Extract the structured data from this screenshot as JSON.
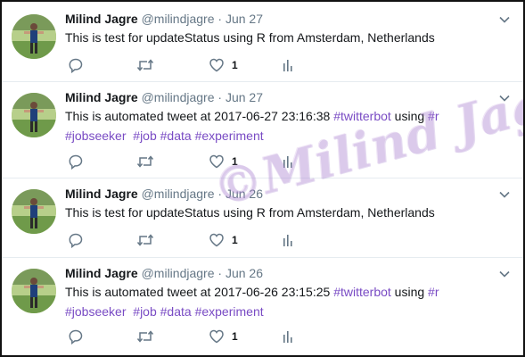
{
  "tweets": [
    {
      "name": "Milind Jagre",
      "handle": "@milindjagre",
      "sep": "·",
      "date": "Jun 27",
      "text_plain": "This is test for updateStatus using R from Amsterdam, Netherlands",
      "likes": "1"
    },
    {
      "name": "Milind Jagre",
      "handle": "@milindjagre",
      "sep": "·",
      "date": "Jun 27",
      "text_a": "This is automated tweet at  2017-06-27 23:16:38 ",
      "tag_twitterbot": "#twitterbot",
      "text_b": " using ",
      "tag_r": "#r",
      "tag_jobseeker": "#jobseeker",
      "tag_job": "#job",
      "tag_data": "#data",
      "tag_experiment": "#experiment",
      "likes": "1"
    },
    {
      "name": "Milind Jagre",
      "handle": "@milindjagre",
      "sep": "·",
      "date": "Jun 26",
      "text_plain": "This is test for updateStatus using R from Amsterdam, Netherlands",
      "likes": "1"
    },
    {
      "name": "Milind Jagre",
      "handle": "@milindjagre",
      "sep": "·",
      "date": "Jun 26",
      "text_a": "This is automated tweet at  2017-06-26 23:15:25 ",
      "tag_twitterbot": "#twitterbot",
      "text_b": " using ",
      "tag_r": "#r",
      "tag_jobseeker": "#jobseeker",
      "tag_job": "#job",
      "tag_data": "#data",
      "tag_experiment": "#experiment",
      "likes": "1"
    }
  ],
  "watermark": "©Milind Jagre",
  "colors": {
    "hashtag": "#794bc4",
    "muted": "#657786",
    "icon": "#657786"
  },
  "icons": [
    "avatar",
    "chevron-down-icon",
    "reply-icon",
    "retweet-icon",
    "heart-icon",
    "analytics-icon"
  ]
}
